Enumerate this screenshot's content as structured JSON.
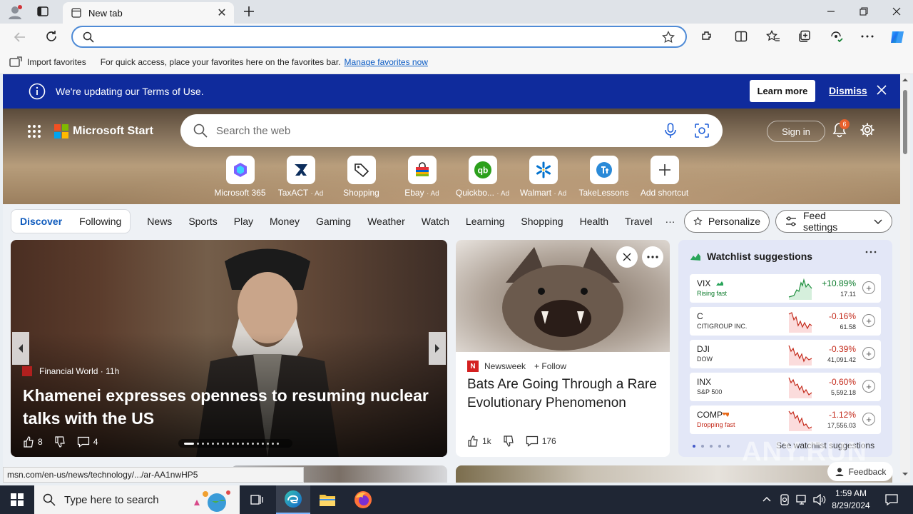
{
  "browser": {
    "tab_title": "New tab",
    "favorites": {
      "import_label": "Import favorites",
      "message": "For quick access, place your favorites here on the favorites bar.",
      "manage_link": "Manage favorites now"
    }
  },
  "terms_banner": {
    "message": "We're updating our Terms of Use.",
    "learn_more": "Learn more",
    "dismiss": "Dismiss"
  },
  "header": {
    "brand": "Microsoft Start",
    "search_placeholder": "Search the web",
    "sign_in": "Sign in",
    "notification_count": "6"
  },
  "shortcuts": [
    {
      "label": "Microsoft 365",
      "ad": ""
    },
    {
      "label": "TaxACT",
      "ad": "· Ad"
    },
    {
      "label": "Shopping",
      "ad": ""
    },
    {
      "label": "Ebay",
      "ad": "· Ad"
    },
    {
      "label": "Quickbo...",
      "ad": "· Ad"
    },
    {
      "label": "Walmart",
      "ad": "· Ad"
    },
    {
      "label": "TakeLessons",
      "ad": ""
    },
    {
      "label": "Add shortcut",
      "ad": ""
    }
  ],
  "nav": {
    "discover": "Discover",
    "following": "Following",
    "items": [
      "News",
      "Sports",
      "Play",
      "Money",
      "Gaming",
      "Weather",
      "Watch",
      "Learning",
      "Shopping",
      "Health",
      "Travel"
    ],
    "more": "···",
    "personalize": "Personalize",
    "feed_settings": "Feed settings"
  },
  "main_story": {
    "source": "Financial World · 11h",
    "headline": "Khamenei expresses openness to resuming nuclear talks with the US",
    "likes": "8",
    "comments": "4"
  },
  "bat_story": {
    "source": "Newsweek",
    "follow": "Follow",
    "headline": "Bats Are Going Through a Rare Evolutionary Phenomenon",
    "likes": "1k",
    "comments": "176"
  },
  "watchlist": {
    "title": "Watchlist suggestions",
    "rows": [
      {
        "symbol": "VIX",
        "sub": "Rising fast",
        "change": "+10.89%",
        "price": "17.11",
        "dir": "up"
      },
      {
        "symbol": "C",
        "sub": "CITIGROUP INC.",
        "change": "-0.16%",
        "price": "61.58",
        "dir": "down"
      },
      {
        "symbol": "DJI",
        "sub": "DOW",
        "change": "-0.39%",
        "price": "41,091.42",
        "dir": "down"
      },
      {
        "symbol": "INX",
        "sub": "S&P 500",
        "change": "-0.60%",
        "price": "5,592.18",
        "dir": "down"
      },
      {
        "symbol": "COMP",
        "sub": "Dropping fast",
        "change": "-1.12%",
        "price": "17,556.03",
        "dir": "down"
      }
    ],
    "see_all": "See watchlist suggestions"
  },
  "status_url": "msn.com/en-us/news/technology/.../ar-AA1nwHP5",
  "feedback": "Feedback",
  "watermark": "ANY.RUN",
  "taskbar": {
    "search_placeholder": "Type here to search",
    "time": "1:59 AM",
    "date": "8/29/2024"
  },
  "colors": {
    "banner_blue": "#0f2b9c",
    "link_blue": "#0f5bbd",
    "gain_green": "#0a7a2a",
    "loss_red": "#c42b1c"
  }
}
